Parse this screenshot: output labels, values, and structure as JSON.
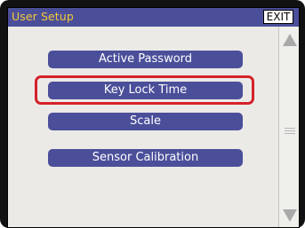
{
  "header": {
    "title": "User Setup",
    "exit_label": "EXIT"
  },
  "menu": {
    "items": [
      {
        "label": "Active Password"
      },
      {
        "label": "Key Lock Time"
      },
      {
        "label": "Scale"
      },
      {
        "label": "Sensor Calibration"
      }
    ],
    "highlighted_index": 1
  },
  "colors": {
    "titlebar": "#4b4f9a",
    "title_text": "#f3c936",
    "button": "#4b4f9a",
    "highlight": "#d5212a",
    "screen_bg": "#ebeae6"
  },
  "icons": {
    "scroll_up": "triangle-up-icon",
    "scroll_down": "triangle-down-icon",
    "scroll_thumb": "grip-lines-icon"
  }
}
